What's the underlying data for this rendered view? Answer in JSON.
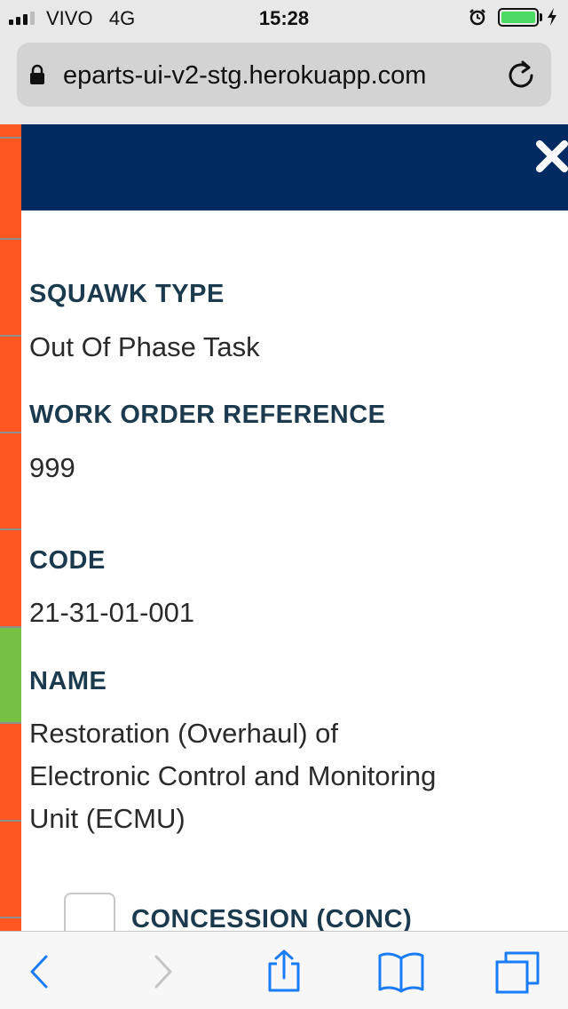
{
  "status_bar": {
    "carrier": "VIVO",
    "network": "4G",
    "time": "15:28",
    "battery_level": 1.0
  },
  "browser": {
    "url": "eparts-ui-v2-stg.herokuapp.com"
  },
  "colors": {
    "header": "#012a63",
    "strip_primary": "#ff5722",
    "strip_accent": "#76c043",
    "label": "#1b3a4e",
    "safari_blue": "#1a7cf5"
  },
  "icons": {
    "close": "close-icon",
    "lock": "lock-icon",
    "reload": "reload-icon",
    "back": "back-icon",
    "forward": "forward-icon",
    "share": "share-icon",
    "bookmarks": "bookmarks-icon",
    "tabs": "tabs-icon"
  },
  "details": {
    "squawk_type": {
      "label": "SQUAWK TYPE",
      "value": "Out Of Phase Task"
    },
    "work_order_reference": {
      "label": "WORK ORDER REFERENCE",
      "value": "999"
    },
    "code": {
      "label": "CODE",
      "value": "21-31-01-001"
    },
    "name": {
      "label": "NAME",
      "lines": [
        "Restoration (Overhaul) of",
        "Electronic Control and Monitoring",
        "Unit (ECMU)"
      ]
    },
    "concession": {
      "label": "CONCESSION (CONC)",
      "checked": false
    }
  }
}
